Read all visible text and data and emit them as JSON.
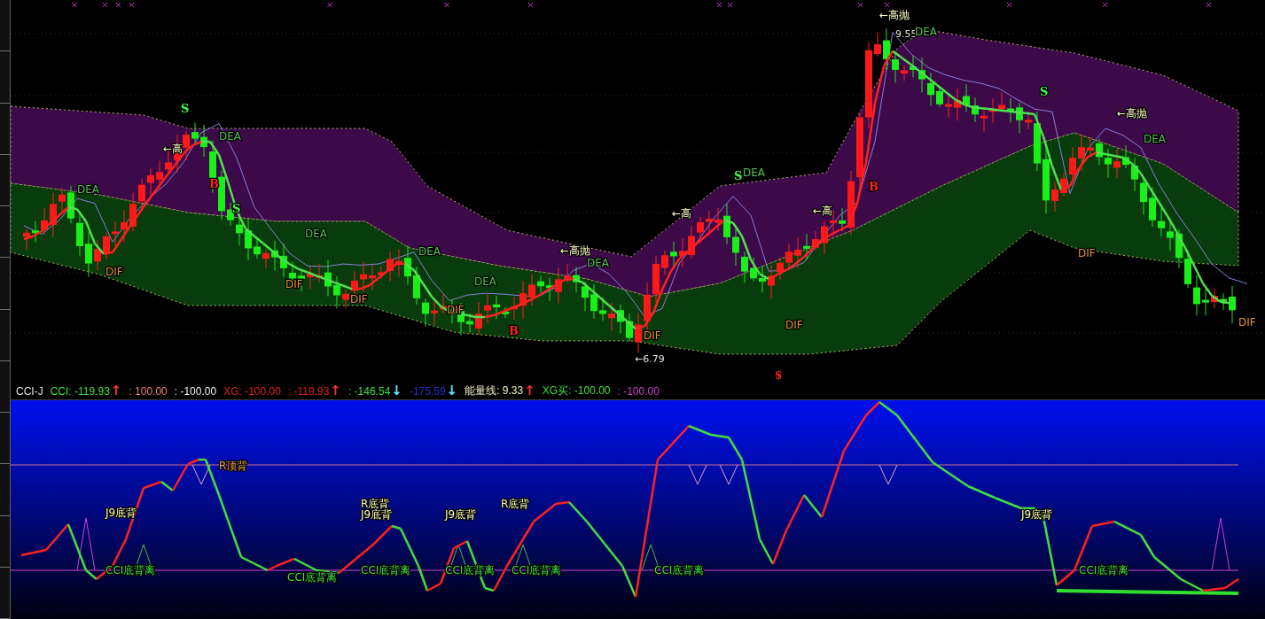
{
  "price_panel": {
    "labels": [
      {
        "kind": "top",
        "text": "←高抛"
      },
      {
        "kind": "price",
        "text": "9.55"
      },
      {
        "kind": "dea",
        "text": "DEA"
      },
      {
        "kind": "sell",
        "text": "S"
      },
      {
        "kind": "buy",
        "text": "B"
      },
      {
        "kind": "top",
        "text": "←高"
      },
      {
        "kind": "dea",
        "text": "DEA"
      },
      {
        "kind": "dea",
        "text": "DEA"
      },
      {
        "kind": "dif",
        "text": "DIF"
      },
      {
        "kind": "sell",
        "text": "S"
      },
      {
        "kind": "dea",
        "text": "DEA"
      },
      {
        "kind": "dif",
        "text": "DIF"
      },
      {
        "kind": "dif",
        "text": "DIF"
      },
      {
        "kind": "dea",
        "text": "DEA"
      },
      {
        "kind": "dif",
        "text": "DIF"
      },
      {
        "kind": "dea",
        "text": "DEA"
      },
      {
        "kind": "buy",
        "text": "B"
      },
      {
        "kind": "top",
        "text": "←高抛"
      },
      {
        "kind": "dea",
        "text": "DEA"
      },
      {
        "kind": "dif",
        "text": "DIF"
      },
      {
        "kind": "price",
        "text": "←6.79"
      },
      {
        "kind": "top",
        "text": "←高"
      },
      {
        "kind": "sell",
        "text": "S"
      },
      {
        "kind": "dea",
        "text": "DEA"
      },
      {
        "kind": "top",
        "text": "←高"
      },
      {
        "kind": "buy",
        "text": "B"
      },
      {
        "kind": "dif",
        "text": "DIF"
      },
      {
        "kind": "sell",
        "text": "S"
      },
      {
        "kind": "top",
        "text": "←高抛"
      },
      {
        "kind": "dea",
        "text": "DEA"
      },
      {
        "kind": "dif",
        "text": "DIF"
      },
      {
        "kind": "dif",
        "text": "DIF"
      },
      {
        "kind": "signal",
        "text": "$"
      }
    ]
  },
  "indicator_header": {
    "name": "CCI-J",
    "readings": [
      {
        "text": "CCI: -119.93",
        "color": "#40e040",
        "arrow": {
          "text": "↑",
          "color": "#ff3030"
        }
      },
      {
        "text": ": 100.00",
        "color": "#f08080"
      },
      {
        "text": ": -100.00",
        "color": "#f0f0f0"
      },
      {
        "text": "XG: -100.00",
        "color": "#e02020"
      },
      {
        "text": ": -119.93",
        "color": "#e02020",
        "arrow": {
          "text": "↑",
          "color": "#ff3030"
        }
      },
      {
        "text": ": -146.54",
        "color": "#40e040",
        "arrow": {
          "text": "↓",
          "color": "#60e0ff"
        }
      },
      {
        "text": "-175.59",
        "color": "#2030c0",
        "arrow": {
          "text": "↓",
          "color": "#60e0ff"
        }
      },
      {
        "text": "能量线: 9.33",
        "color": "#f0f0c0",
        "arrow": {
          "text": "↑",
          "color": "#ff3030"
        }
      },
      {
        "text": "XG买: -100.00",
        "color": "#40e040"
      },
      {
        "text": ": -100.00",
        "color": "#d040d0"
      }
    ]
  },
  "indicator_panel": {
    "labels": [
      {
        "kind": "top_div",
        "text": "R顶背"
      },
      {
        "kind": "bottom",
        "text": "J9底背"
      },
      {
        "kind": "bottom",
        "text": "R底背"
      },
      {
        "kind": "bottom",
        "text": "J9底背"
      },
      {
        "kind": "bottom",
        "text": "J9底背"
      },
      {
        "kind": "bottom",
        "text": "R底背"
      },
      {
        "kind": "bottom",
        "text": "J9底背"
      },
      {
        "kind": "cci",
        "text": "CCI底背离"
      },
      {
        "kind": "cci",
        "text": "CCI底背离"
      },
      {
        "kind": "cci",
        "text": "CCI底背离"
      },
      {
        "kind": "cci",
        "text": "CCI底背离"
      },
      {
        "kind": "cci",
        "text": "CCI底背离"
      },
      {
        "kind": "cci",
        "text": "CCI底背离"
      },
      {
        "kind": "cci",
        "text": "CCI底背离"
      }
    ]
  }
}
